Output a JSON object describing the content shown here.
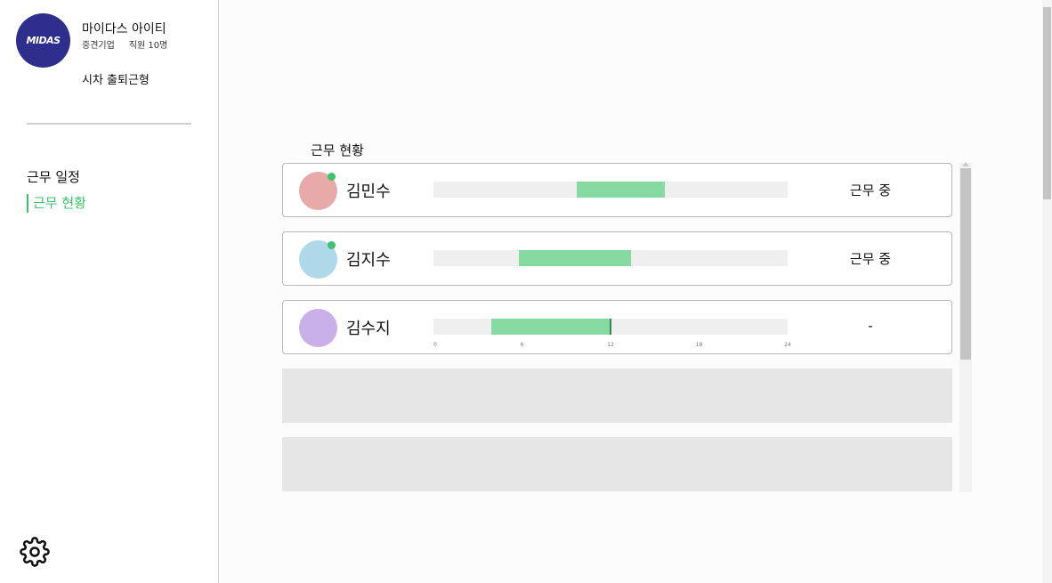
{
  "sidebar": {
    "logo_text": "MIDAS",
    "company_name": "마이다스 아이티",
    "company_type": "중견기업",
    "employee_count": "직원 10명",
    "work_type": "시차 출퇴근형",
    "nav": [
      {
        "label": "근무 일정",
        "active": false
      },
      {
        "label": "근무 현황",
        "active": true
      }
    ],
    "settings_icon": "gear-icon",
    "accent_color": "#3cc36b",
    "logo_color": "#2e2e8c"
  },
  "main": {
    "section_title": "근무 현황",
    "employees": [
      {
        "name": "김민수",
        "avatar_color": "#e8a9a9",
        "online": true,
        "work_start_hour": 9.7,
        "work_end_hour": 15.7,
        "status": "근무 중"
      },
      {
        "name": "김지수",
        "avatar_color": "#afd9e8",
        "online": true,
        "work_start_hour": 5.8,
        "work_end_hour": 13.4,
        "status": "근무 중"
      },
      {
        "name": "김수지",
        "avatar_color": "#c9b0e8",
        "online": false,
        "work_start_hour": 3.9,
        "work_end_hour": 12.0,
        "current_hour": 12.0,
        "status": "-"
      }
    ],
    "timeline_ticks": [
      "0",
      "6",
      "12",
      "18",
      "24"
    ],
    "timeline_max_hour": 24,
    "empty_rows": 2
  }
}
